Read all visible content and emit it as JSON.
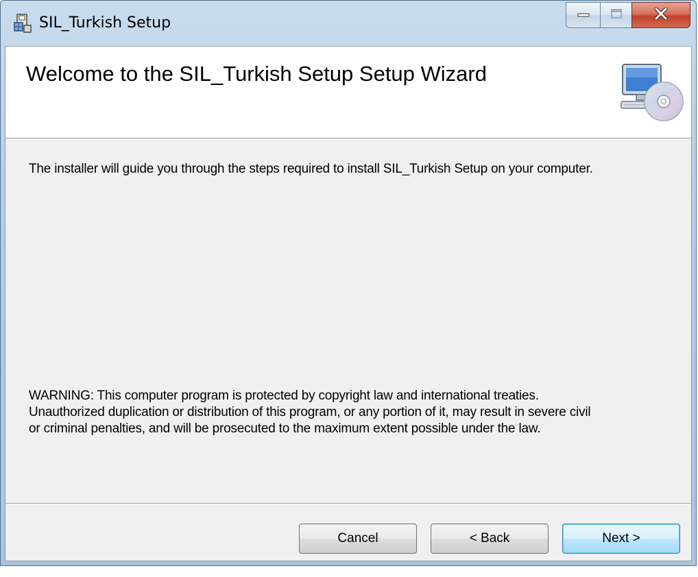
{
  "window": {
    "title": "SIL_Turkish Setup",
    "icons": {
      "app": "installer-app-icon",
      "minimize": "minimize-icon",
      "maximize": "maximize-icon",
      "close": "close-icon"
    }
  },
  "banner": {
    "title": "Welcome to the SIL_Turkish Setup Setup Wizard",
    "icon": "computer-disc-icon"
  },
  "body": {
    "intro": "The installer will guide you through the steps required to install SIL_Turkish Setup on your computer.",
    "warning": "WARNING: This computer program is protected by copyright law and international treaties.\nUnauthorized duplication or distribution of this program, or any portion of it, may result in severe civil\nor criminal penalties, and will be prosecuted to the maximum extent possible under the law."
  },
  "buttons": {
    "cancel": "Cancel",
    "back": "< Back",
    "next": "Next >"
  },
  "colors": {
    "close_button": "#c4412a",
    "default_button_border": "#3c7fb1",
    "client_background": "#f0f0f0"
  }
}
